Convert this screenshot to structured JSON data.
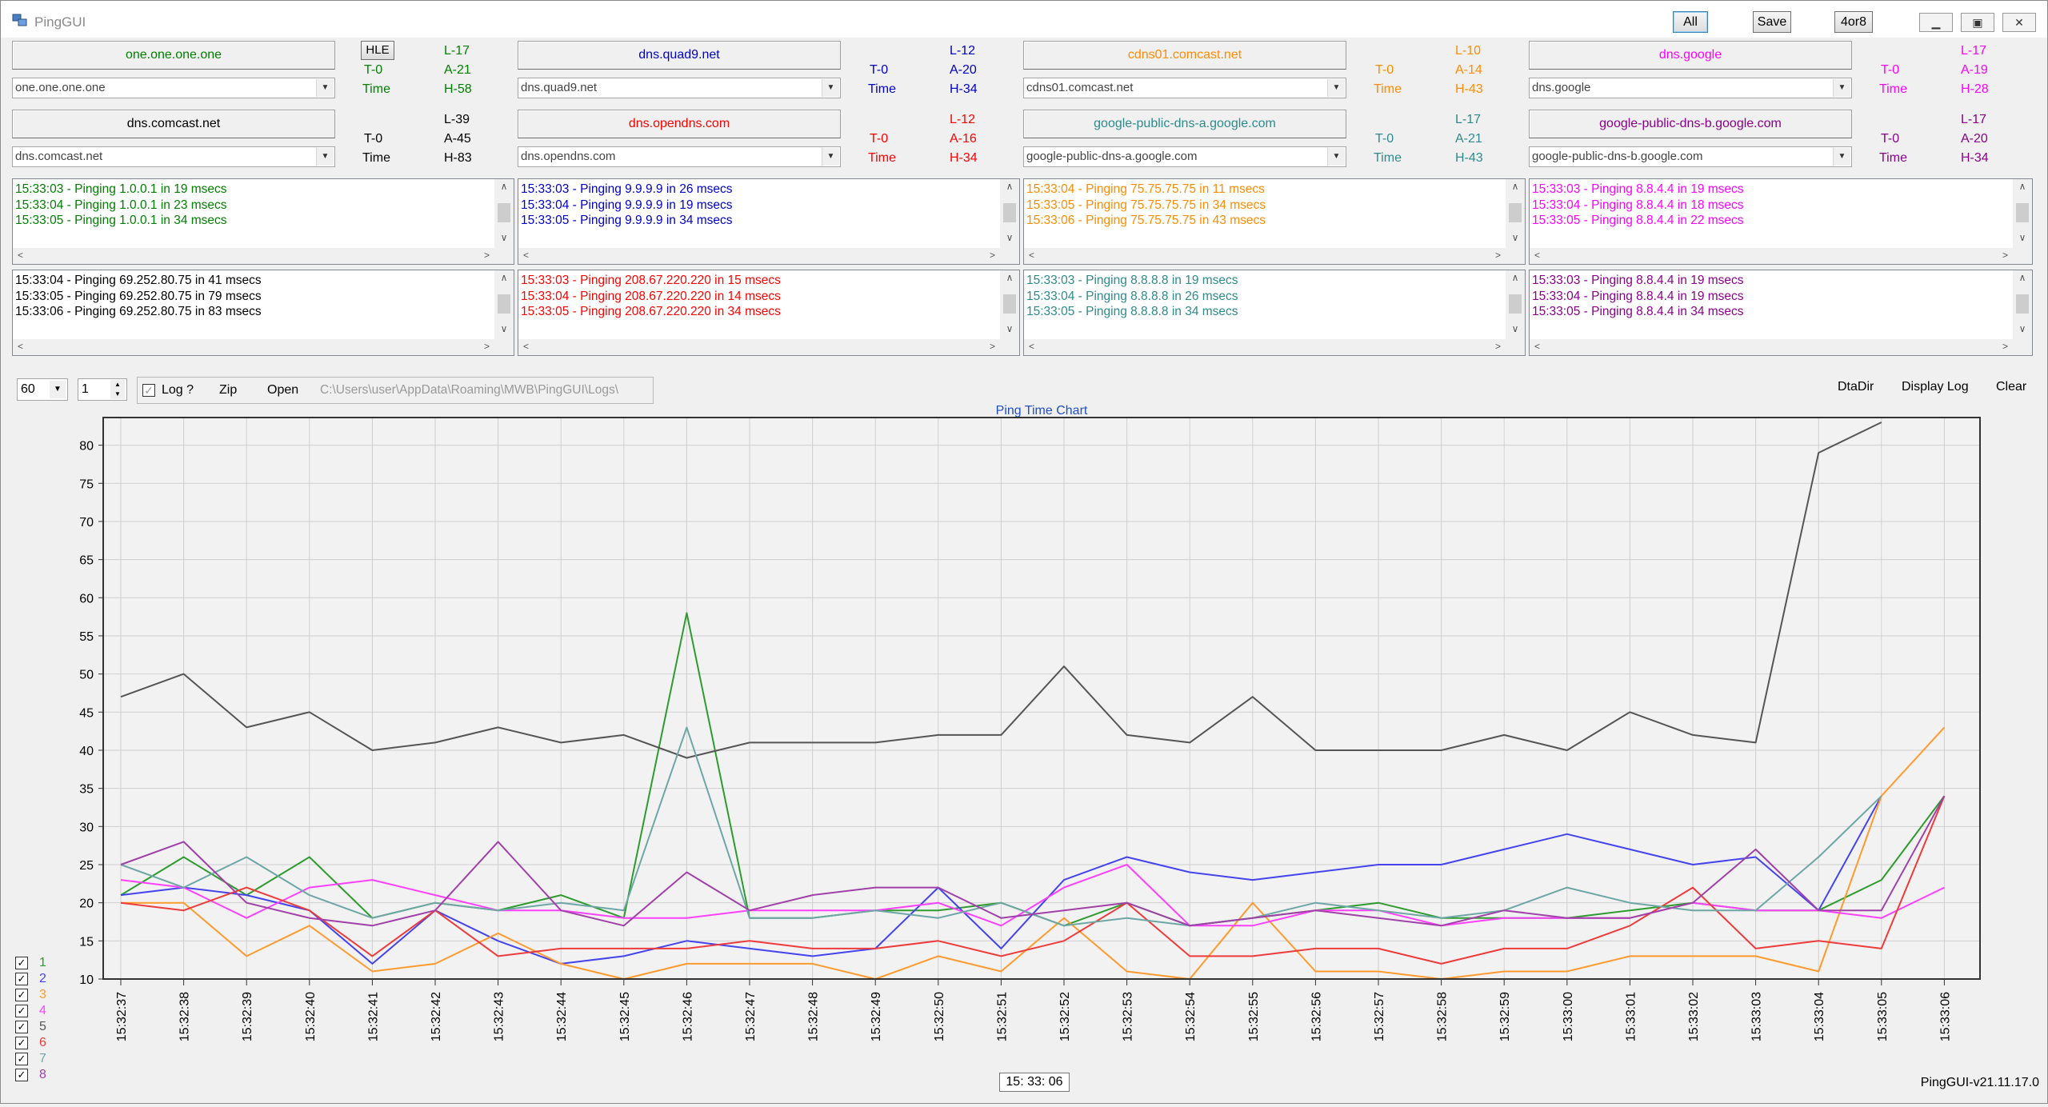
{
  "app": {
    "title": "PingGUI",
    "btn_all": "All",
    "btn_save": "Save",
    "btn_4or8": "4or8",
    "hle": "HLE"
  },
  "hosts": [
    {
      "title": "one.one.one.one",
      "combo": "one.one.one.one",
      "t": "T-0",
      "time": "Time",
      "l": "L-17",
      "a": "A-21",
      "h": "H-58",
      "color": "#008000",
      "log": [
        "15:33:03 - Pinging 1.0.0.1 in 19 msecs",
        "15:33:04 - Pinging 1.0.0.1 in 23 msecs",
        "15:33:05 - Pinging 1.0.0.1 in 34 msecs"
      ]
    },
    {
      "title": "dns.quad9.net",
      "combo": "dns.quad9.net",
      "t": "T-0",
      "time": "Time",
      "l": "L-12",
      "a": "A-20",
      "h": "H-34",
      "color": "#0000cc",
      "log": [
        "15:33:03 - Pinging 9.9.9.9 in 26 msecs",
        "15:33:04 - Pinging 9.9.9.9 in 19 msecs",
        "15:33:05 - Pinging 9.9.9.9 in 34 msecs"
      ]
    },
    {
      "title": "cdns01.comcast.net",
      "combo": "cdns01.comcast.net",
      "t": "T-0",
      "time": "Time",
      "l": "L-10",
      "a": "A-14",
      "h": "H-43",
      "color": "#ff8c00",
      "log": [
        "15:33:04 - Pinging 75.75.75.75 in 11 msecs",
        "15:33:05 - Pinging 75.75.75.75 in 34 msecs",
        "15:33:06 - Pinging 75.75.75.75 in 43 msecs"
      ]
    },
    {
      "title": "dns.google",
      "combo": "dns.google",
      "t": "T-0",
      "time": "Time",
      "l": "L-17",
      "a": "A-19",
      "h": "H-28",
      "color": "#ff00ff",
      "log": [
        "15:33:03 - Pinging 8.8.4.4 in 19 msecs",
        "15:33:04 - Pinging 8.8.4.4 in 18 msecs",
        "15:33:05 - Pinging 8.8.4.4 in 22 msecs"
      ]
    },
    {
      "title": "dns.comcast.net",
      "combo": "dns.comcast.net",
      "t": "T-0",
      "time": "Time",
      "l": "L-39",
      "a": "A-45",
      "h": "H-83",
      "color": "#000000",
      "log": [
        "15:33:04 - Pinging 69.252.80.75 in 41 msecs",
        "15:33:05 - Pinging 69.252.80.75 in 79 msecs",
        "15:33:06 - Pinging 69.252.80.75 in 83 msecs"
      ]
    },
    {
      "title": "dns.opendns.com",
      "combo": "dns.opendns.com",
      "t": "T-0",
      "time": "Time",
      "l": "L-12",
      "a": "A-16",
      "h": "H-34",
      "color": "#ff0000",
      "log": [
        "15:33:03 - Pinging 208.67.220.220 in 15 msecs",
        "15:33:04 - Pinging 208.67.220.220 in 14 msecs",
        "15:33:05 - Pinging 208.67.220.220 in 34 msecs"
      ]
    },
    {
      "title": "google-public-dns-a.google.com",
      "combo": "google-public-dns-a.google.com",
      "t": "T-0",
      "time": "Time",
      "l": "L-17",
      "a": "A-21",
      "h": "H-43",
      "color": "#2e8b8b",
      "log": [
        "15:33:03 - Pinging 8.8.8.8 in 19 msecs",
        "15:33:04 - Pinging 8.8.8.8 in 26 msecs",
        "15:33:05 - Pinging 8.8.8.8 in 34 msecs"
      ]
    },
    {
      "title": "google-public-dns-b.google.com",
      "combo": "google-public-dns-b.google.com",
      "t": "T-0",
      "time": "Time",
      "l": "L-17",
      "a": "A-20",
      "h": "H-34",
      "color": "#8b008b",
      "log": [
        "15:33:03 - Pinging 8.8.4.4 in 19 msecs",
        "15:33:04 - Pinging 8.8.4.4 in 19 msecs",
        "15:33:05 - Pinging 8.8.4.4 in 34 msecs"
      ]
    }
  ],
  "controls": {
    "interval": "60",
    "step": "1",
    "log_label": "Log ?",
    "zip": "Zip",
    "open": "Open",
    "log_path": "C:\\Users\\user\\AppData\\Roaming\\MWB\\PingGUI\\Logs\\",
    "dtadir": "DtaDir",
    "display_log": "Display Log",
    "clear": "Clear"
  },
  "legend": [
    "1",
    "2",
    "3",
    "4",
    "5",
    "6",
    "7",
    "8"
  ],
  "footer": {
    "time": "15: 33: 06",
    "version": "PingGUI-v21.11.17.0"
  },
  "chart_data": {
    "type": "line",
    "title": "Ping Time Chart",
    "ylim": [
      10,
      83
    ],
    "yticks": [
      10,
      15,
      20,
      25,
      30,
      35,
      40,
      45,
      50,
      55,
      60,
      65,
      70,
      75,
      80
    ],
    "x": [
      "15:32:37",
      "15:32:38",
      "15:32:39",
      "15:32:40",
      "15:32:41",
      "15:32:42",
      "15:32:43",
      "15:32:44",
      "15:32:45",
      "15:32:46",
      "15:32:47",
      "15:32:48",
      "15:32:49",
      "15:32:50",
      "15:32:51",
      "15:32:52",
      "15:32:53",
      "15:32:54",
      "15:32:55",
      "15:32:56",
      "15:32:57",
      "15:32:58",
      "15:32:59",
      "15:33:00",
      "15:33:01",
      "15:33:02",
      "15:33:03",
      "15:33:04",
      "15:33:05",
      "15:33:06"
    ],
    "grid": true,
    "series": [
      {
        "name": "1",
        "color": "#2e9b2e",
        "values": [
          21,
          26,
          21,
          26,
          18,
          20,
          19,
          21,
          18,
          58,
          18,
          18,
          19,
          19,
          20,
          17,
          20,
          17,
          18,
          19,
          20,
          18,
          18,
          18,
          19,
          20,
          19,
          19,
          23,
          34
        ]
      },
      {
        "name": "2",
        "color": "#4444ee",
        "values": [
          21,
          22,
          21,
          19,
          12,
          19,
          15,
          12,
          13,
          15,
          14,
          13,
          14,
          22,
          14,
          23,
          26,
          24,
          23,
          24,
          25,
          25,
          27,
          29,
          27,
          25,
          26,
          19,
          34,
          null
        ]
      },
      {
        "name": "3",
        "color": "#ff9a2e",
        "values": [
          20,
          20,
          13,
          17,
          11,
          12,
          16,
          12,
          10,
          12,
          12,
          12,
          10,
          13,
          11,
          18,
          11,
          10,
          20,
          11,
          11,
          10,
          11,
          11,
          13,
          13,
          13,
          11,
          34,
          43
        ]
      },
      {
        "name": "4",
        "color": "#ff40ff",
        "values": [
          23,
          22,
          18,
          22,
          23,
          21,
          19,
          19,
          18,
          18,
          19,
          19,
          19,
          20,
          17,
          22,
          25,
          17,
          17,
          19,
          19,
          17,
          18,
          18,
          18,
          20,
          19,
          19,
          18,
          22
        ]
      },
      {
        "name": "5",
        "color": "#555555",
        "values": [
          47,
          50,
          43,
          45,
          40,
          41,
          43,
          41,
          42,
          39,
          41,
          41,
          41,
          42,
          42,
          51,
          42,
          41,
          47,
          40,
          40,
          40,
          42,
          40,
          45,
          42,
          41,
          79,
          83,
          null
        ]
      },
      {
        "name": "6",
        "color": "#ee3b3b",
        "values": [
          20,
          19,
          22,
          19,
          13,
          19,
          13,
          14,
          14,
          14,
          15,
          14,
          14,
          15,
          13,
          15,
          20,
          13,
          13,
          14,
          14,
          12,
          14,
          14,
          17,
          22,
          14,
          15,
          14,
          34
        ]
      },
      {
        "name": "7",
        "color": "#6ea6a6",
        "values": [
          25,
          22,
          26,
          21,
          18,
          20,
          19,
          20,
          19,
          43,
          18,
          18,
          19,
          18,
          20,
          17,
          18,
          17,
          18,
          20,
          19,
          18,
          19,
          22,
          20,
          19,
          19,
          26,
          34,
          null
        ]
      },
      {
        "name": "8",
        "color": "#a040a8",
        "values": [
          25,
          28,
          20,
          18,
          17,
          19,
          28,
          19,
          17,
          24,
          19,
          21,
          22,
          22,
          18,
          19,
          20,
          17,
          18,
          19,
          18,
          17,
          19,
          18,
          18,
          20,
          27,
          19,
          19,
          34
        ]
      }
    ]
  }
}
